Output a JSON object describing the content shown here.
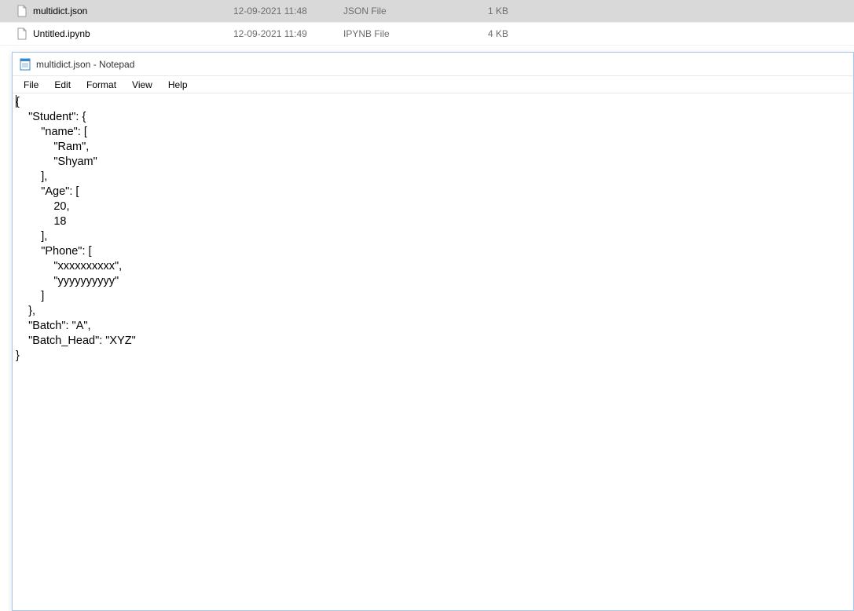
{
  "file_explorer": {
    "rows": [
      {
        "name": "multidict.json",
        "date": "12-09-2021 11:48",
        "type": "JSON File",
        "size": "1 KB",
        "selected": true
      },
      {
        "name": "Untitled.ipynb",
        "date": "12-09-2021 11:49",
        "type": "IPYNB File",
        "size": "4 KB",
        "selected": false
      }
    ]
  },
  "notepad": {
    "title": "multidict.json - Notepad",
    "menu": {
      "file": "File",
      "edit": "Edit",
      "format": "Format",
      "view": "View",
      "help": "Help"
    },
    "content": "{\n    \"Student\": {\n        \"name\": [\n            \"Ram\",\n            \"Shyam\"\n        ],\n        \"Age\": [\n            20,\n            18\n        ],\n        \"Phone\": [\n            \"xxxxxxxxxx\",\n            \"yyyyyyyyyy\"\n        ]\n    },\n    \"Batch\": \"A\",\n    \"Batch_Head\": \"XYZ\"\n}"
  }
}
